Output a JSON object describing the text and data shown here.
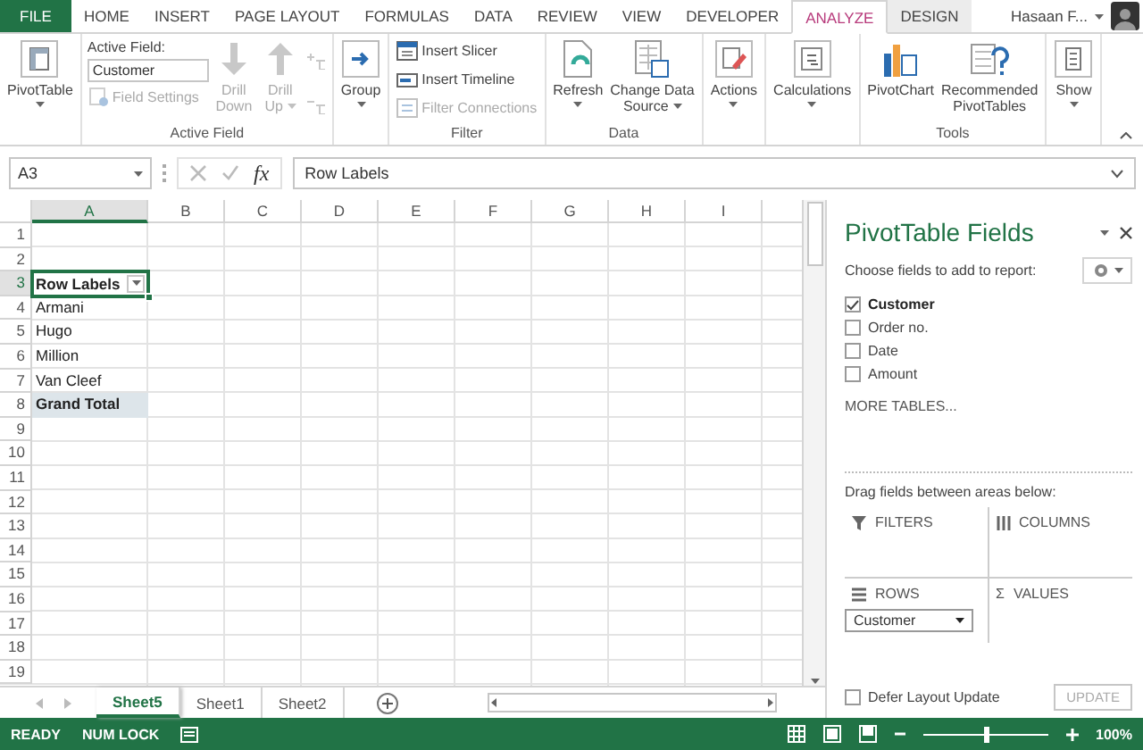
{
  "ribbon_tabs": [
    {
      "label": "FILE",
      "kind": "file",
      "selected": false
    },
    {
      "label": "HOME",
      "kind": "normal",
      "selected": false
    },
    {
      "label": "INSERT",
      "kind": "normal",
      "selected": false
    },
    {
      "label": "PAGE LAYOUT",
      "kind": "normal",
      "selected": false
    },
    {
      "label": "FORMULAS",
      "kind": "normal",
      "selected": false
    },
    {
      "label": "DATA",
      "kind": "normal",
      "selected": false
    },
    {
      "label": "REVIEW",
      "kind": "normal",
      "selected": false
    },
    {
      "label": "VIEW",
      "kind": "normal",
      "selected": false
    },
    {
      "label": "DEVELOPER",
      "kind": "normal",
      "selected": false
    },
    {
      "label": "ANALYZE",
      "kind": "contextual",
      "selected": true
    },
    {
      "label": "DESIGN",
      "kind": "contextual",
      "selected": false
    }
  ],
  "account": {
    "name": "Hasaan F..."
  },
  "ribbon_groups": [
    {
      "items": [
        {
          "kind": "large",
          "label": "PivotTable",
          "dropdown": true,
          "disabled": false
        }
      ]
    },
    {
      "label": "Active Field",
      "items": [
        {
          "kind": "field",
          "label": "Active Field:",
          "value": "Customer",
          "button": {
            "label": "Field Settings",
            "disabled": true
          }
        },
        {
          "kind": "large",
          "label": "Drill\nDown",
          "dropdown": false,
          "disabled": true
        },
        {
          "kind": "large",
          "label": "Drill\nUp",
          "dropdown": true,
          "disabled": true
        },
        {
          "kind": "minis",
          "disabled": true
        }
      ]
    },
    {
      "items": [
        {
          "kind": "large",
          "label": "Group",
          "dropdown": true,
          "disabled": false
        }
      ]
    },
    {
      "label": "Filter",
      "items": [
        {
          "kind": "small",
          "label": "Insert Slicer",
          "disabled": false
        },
        {
          "kind": "small",
          "label": "Insert Timeline",
          "disabled": false
        },
        {
          "kind": "small",
          "label": "Filter Connections",
          "disabled": true
        }
      ]
    },
    {
      "label": "Data",
      "items": [
        {
          "kind": "large",
          "label": "Refresh",
          "dropdown": true,
          "disabled": false
        },
        {
          "kind": "large",
          "label": "Change Data\nSource",
          "dropdown": true,
          "disabled": false
        }
      ]
    },
    {
      "items": [
        {
          "kind": "large",
          "label": "Actions",
          "dropdown": true,
          "disabled": false
        }
      ]
    },
    {
      "items": [
        {
          "kind": "large",
          "label": "Calculations",
          "dropdown": true,
          "disabled": false
        }
      ]
    },
    {
      "label": "Tools",
      "items": [
        {
          "kind": "large",
          "label": "PivotChart",
          "dropdown": false,
          "disabled": false
        },
        {
          "kind": "large",
          "label": "Recommended\nPivotTables",
          "dropdown": false,
          "disabled": false
        }
      ]
    },
    {
      "items": [
        {
          "kind": "large",
          "label": "Show",
          "dropdown": true,
          "disabled": false
        }
      ]
    }
  ],
  "formula_bar": {
    "name_box": "A3",
    "function_label": "fx",
    "formula": "Row Labels"
  },
  "grid": {
    "columns": [
      {
        "label": "A",
        "selected": true
      },
      {
        "label": "B",
        "selected": false
      },
      {
        "label": "C",
        "selected": false
      },
      {
        "label": "D",
        "selected": false
      },
      {
        "label": "E",
        "selected": false
      },
      {
        "label": "F",
        "selected": false
      },
      {
        "label": "G",
        "selected": false
      },
      {
        "label": "H",
        "selected": false
      },
      {
        "label": "I",
        "selected": false
      }
    ],
    "rows": [
      {
        "label": "1",
        "selected": false
      },
      {
        "label": "2",
        "selected": false
      },
      {
        "label": "3",
        "selected": true,
        "cells": [
          {
            "text": "Row Labels",
            "kind": "row-labels",
            "selected": true
          }
        ]
      },
      {
        "label": "4",
        "selected": false,
        "cells": [
          {
            "text": "Armani",
            "kind": "item",
            "selected": false
          }
        ]
      },
      {
        "label": "5",
        "selected": false,
        "cells": [
          {
            "text": "Hugo",
            "kind": "item",
            "selected": false
          }
        ]
      },
      {
        "label": "6",
        "selected": false,
        "cells": [
          {
            "text": "Million",
            "kind": "item",
            "selected": false
          }
        ]
      },
      {
        "label": "7",
        "selected": false,
        "cells": [
          {
            "text": "Van Cleef",
            "kind": "item",
            "selected": false
          }
        ]
      },
      {
        "label": "8",
        "selected": false,
        "cells": [
          {
            "text": "Grand Total",
            "kind": "total",
            "selected": false
          }
        ]
      },
      {
        "label": "9",
        "selected": false
      },
      {
        "label": "10",
        "selected": false
      },
      {
        "label": "11",
        "selected": false
      },
      {
        "label": "12",
        "selected": false
      },
      {
        "label": "13",
        "selected": false
      },
      {
        "label": "14",
        "selected": false
      },
      {
        "label": "15",
        "selected": false
      },
      {
        "label": "16",
        "selected": false
      },
      {
        "label": "17",
        "selected": false
      },
      {
        "label": "18",
        "selected": false
      },
      {
        "label": "19",
        "selected": false
      }
    ]
  },
  "sheet_tabs": [
    {
      "label": "Sheet5",
      "selected": true
    },
    {
      "label": "Sheet1",
      "selected": false
    },
    {
      "label": "Sheet2",
      "selected": false
    }
  ],
  "pivot_panel": {
    "title": "PivotTable Fields",
    "subtitle": "Choose fields to add to report:",
    "fields": [
      {
        "label": "Customer",
        "checked": true
      },
      {
        "label": "Order no.",
        "checked": false
      },
      {
        "label": "Date",
        "checked": false
      },
      {
        "label": "Amount",
        "checked": false
      }
    ],
    "more_tables": "MORE TABLES...",
    "areas_hint": "Drag fields between areas below:",
    "areas": [
      {
        "label": "FILTERS"
      },
      {
        "label": "COLUMNS"
      },
      {
        "label": "ROWS",
        "fields": [
          "Customer"
        ]
      },
      {
        "label": "VALUES",
        "symbol": "Σ"
      }
    ],
    "defer": {
      "label": "Defer Layout Update",
      "checked": false
    },
    "update_button": {
      "label": "UPDATE",
      "disabled": true
    }
  },
  "status_bar": {
    "items": [
      "READY",
      "NUM LOCK"
    ],
    "zoom": {
      "level": 0.5,
      "label": "100%"
    }
  }
}
